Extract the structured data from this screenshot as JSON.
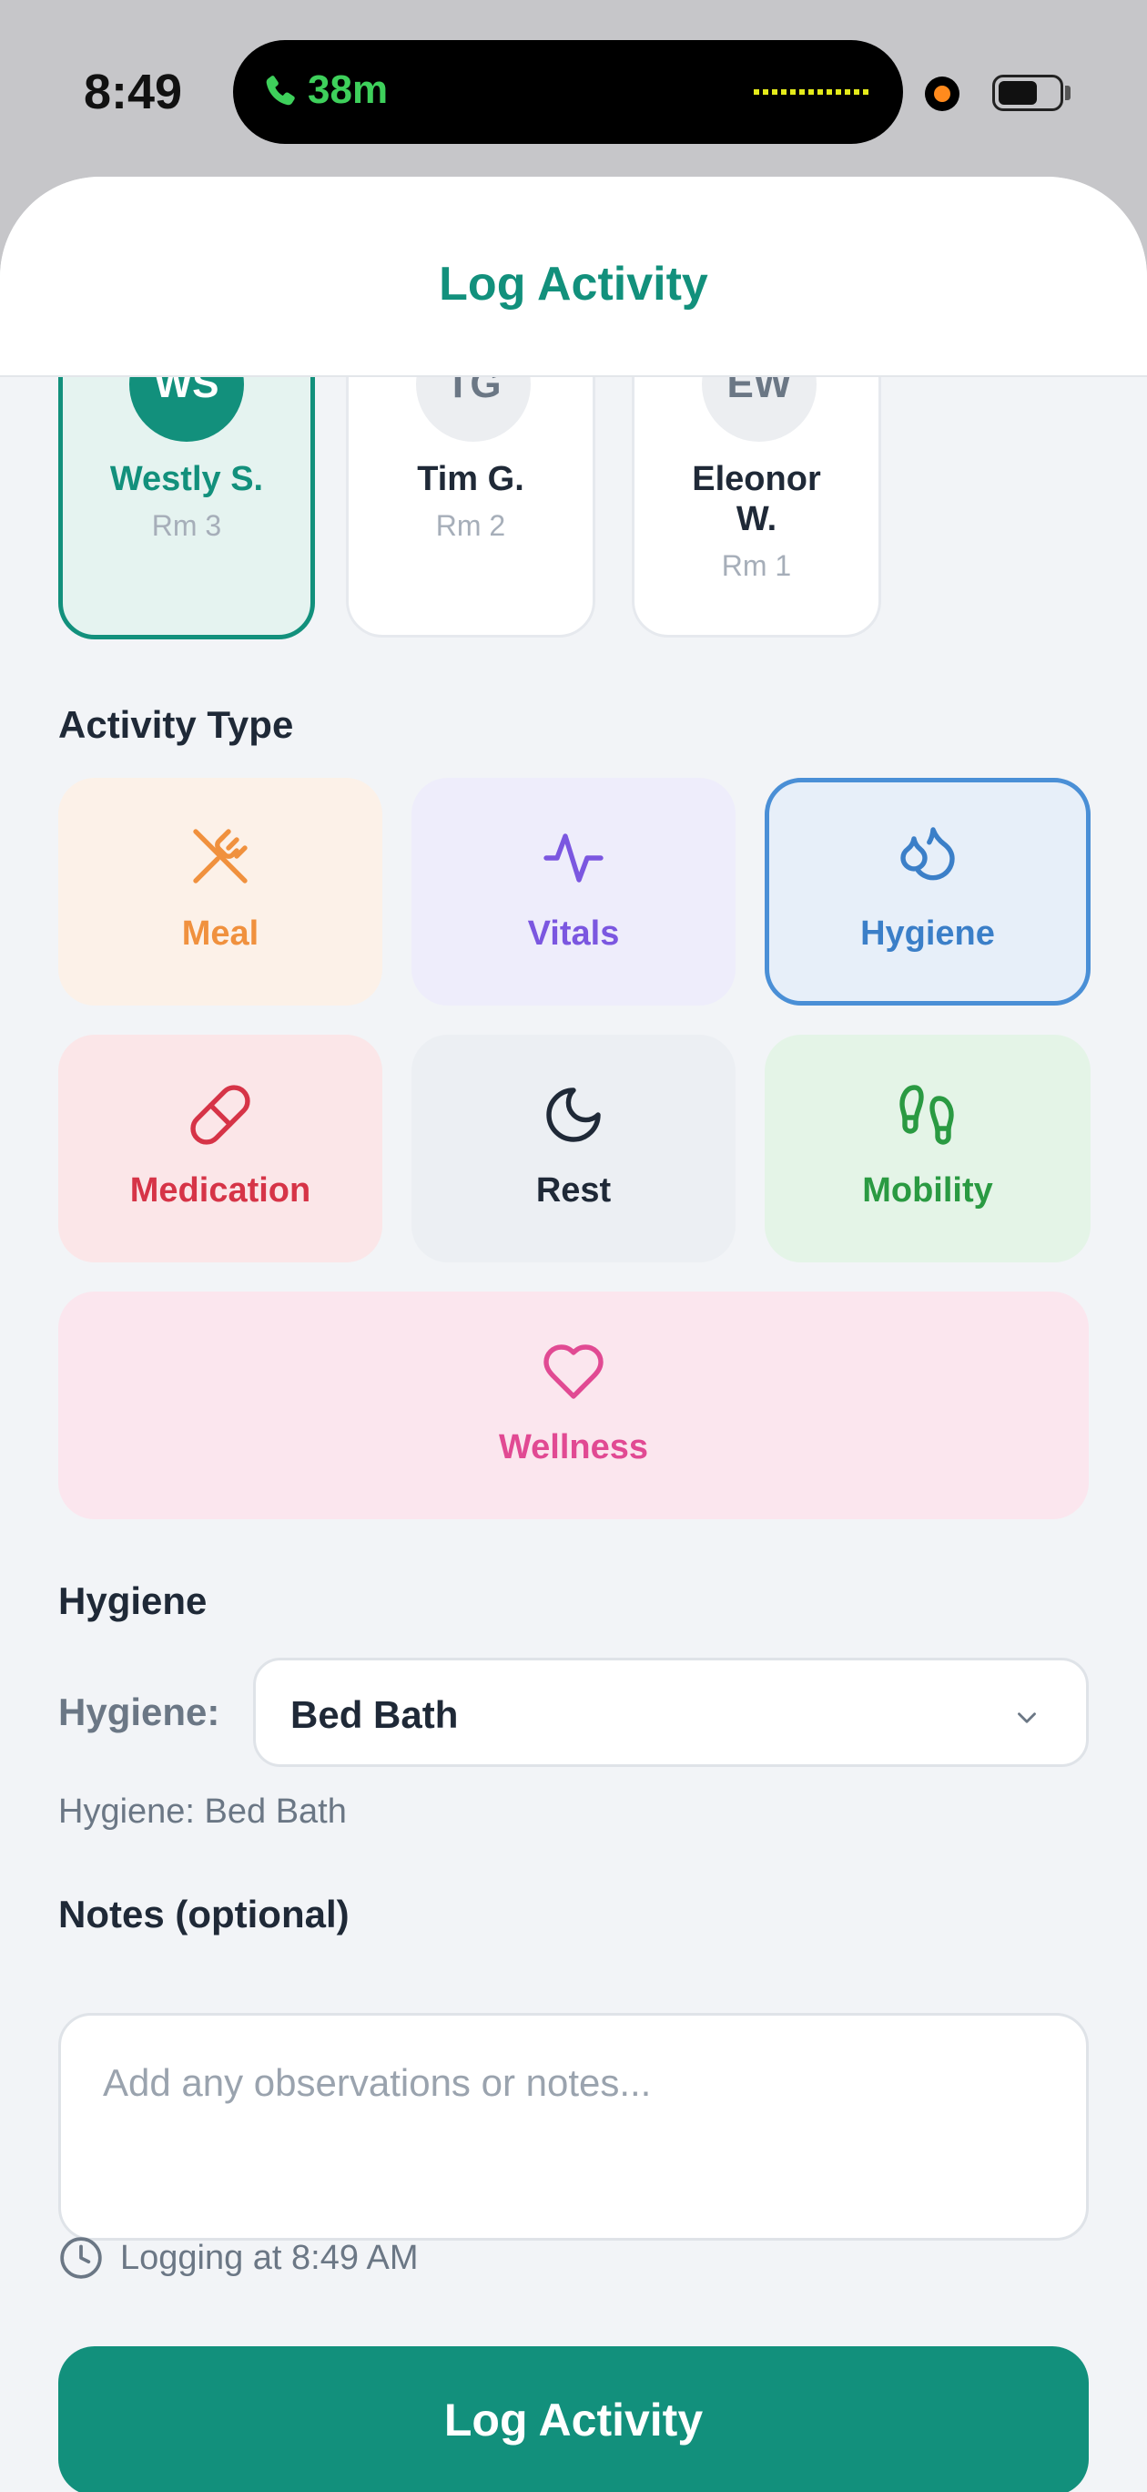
{
  "status_bar": {
    "time": "8:49",
    "call_duration": "38m",
    "call_color": "#3ed05b"
  },
  "header": {
    "title": "Log Activity"
  },
  "residents": [
    {
      "initials": "WS",
      "name": "Westly  S.",
      "room": "Rm 3",
      "selected": true
    },
    {
      "initials": "TG",
      "name": "Tim G.",
      "room": "Rm 2",
      "selected": false
    },
    {
      "initials": "EW",
      "name_line1": "Eleonor",
      "name_line2": "W.",
      "room": "Rm 1",
      "selected": false
    }
  ],
  "activity_section": {
    "label": "Activity Type"
  },
  "activity_types": [
    {
      "label": "Meal",
      "icon": "fork-knife-crossed-icon",
      "color": "#f0913e",
      "bg": "#fcf1e8",
      "selected": false
    },
    {
      "label": "Vitals",
      "icon": "pulse-icon",
      "color": "#7b57e0",
      "bg": "#eeedfb",
      "selected": false
    },
    {
      "label": "Hygiene",
      "icon": "droplets-icon",
      "color": "#3b7fc8",
      "bg": "#e7eff9",
      "selected": true
    },
    {
      "label": "Medication",
      "icon": "pill-icon",
      "color": "#d63447",
      "bg": "#fbe6e8",
      "selected": false
    },
    {
      "label": "Rest",
      "icon": "moon-icon",
      "color": "#1f2937",
      "bg": "#eceff3",
      "selected": false
    },
    {
      "label": "Mobility",
      "icon": "footprints-icon",
      "color": "#2a9a42",
      "bg": "#e4f4e7",
      "selected": false
    },
    {
      "label": "Wellness",
      "icon": "heart-icon",
      "color": "#e14a93",
      "bg": "#fbe6ee",
      "selected": false
    }
  ],
  "detail_section": {
    "label": "Hygiene",
    "field_label": "Hygiene:",
    "selected_value": "Bed Bath",
    "summary": "Hygiene: Bed Bath"
  },
  "notes": {
    "label": "Notes (optional)",
    "placeholder": "Add any observations or notes..."
  },
  "logging_time": "Logging at 8:49 AM",
  "submit": {
    "label": "Log Activity"
  },
  "colors": {
    "accent": "#12907c",
    "selected_tile_border": "#4a8fd6"
  }
}
